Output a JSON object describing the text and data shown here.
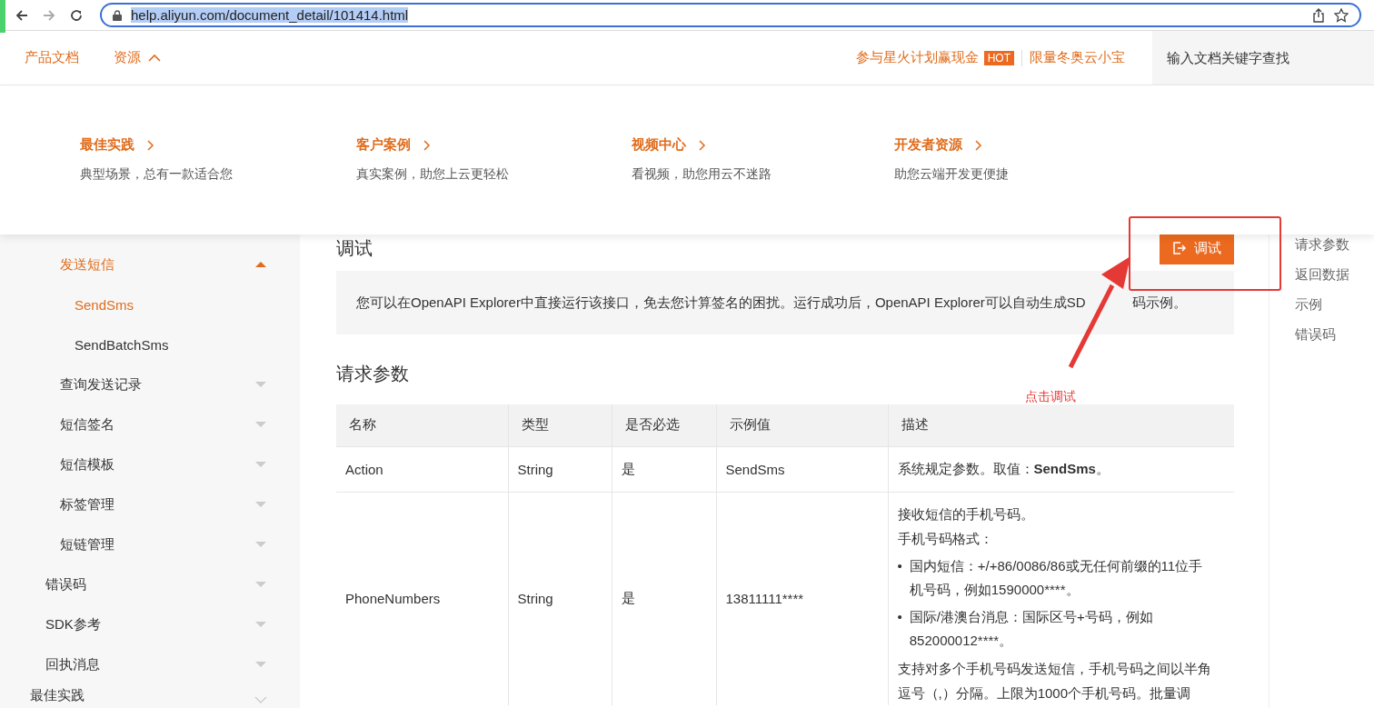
{
  "browser": {
    "url": "help.aliyun.com/document_detail/101414.html",
    "url_selected": true
  },
  "header": {
    "nav": [
      {
        "label": "产品文档",
        "kind": "link"
      },
      {
        "label": "资源",
        "kind": "menu",
        "expanded": true
      }
    ],
    "promo": {
      "label": "参与星火计划赢现金",
      "badge": "HOT"
    },
    "promo_2": "限量冬奥云小宝",
    "search": {
      "placeholder": "输入文档关键字查找"
    }
  },
  "dropdown": [
    {
      "title": "最佳实践",
      "desc": "典型场景，总有一款适合您"
    },
    {
      "title": "客户案例",
      "desc": "真实案例，助您上云更轻松"
    },
    {
      "title": "视频中心",
      "desc": "看视频，助您用云不迷路"
    },
    {
      "title": "开发者资源",
      "desc": "助您云端开发更便捷"
    }
  ],
  "sidebar": {
    "level_2": [
      {
        "label": "发送短信",
        "expanded": true,
        "children": [
          {
            "label": "SendSms",
            "selected": true
          },
          {
            "label": "SendBatchSms",
            "selected": false
          }
        ]
      },
      {
        "label": "查询发送记录",
        "expanded": false
      },
      {
        "label": "短信签名",
        "expanded": false
      },
      {
        "label": "短信模板",
        "expanded": false
      },
      {
        "label": "标签管理",
        "expanded": false
      },
      {
        "label": "短链管理",
        "expanded": false
      }
    ],
    "level_1": [
      {
        "label": "错误码",
        "expanded": false
      },
      {
        "label": "SDK参考",
        "expanded": false
      },
      {
        "label": "回执消息",
        "expanded": false
      }
    ],
    "level_0": [
      {
        "label": "最佳实践",
        "expanded": false
      }
    ]
  },
  "content": {
    "debug_heading": "调试",
    "debug_button": "调试",
    "debug_info": [
      "您可以在OpenAPI Explorer中直接运行该接口，免去您计算签名的困扰。运行成功后，OpenAPI Explorer可以自动生成SD",
      "码示例。"
    ],
    "params_heading": "请求参数",
    "table": {
      "columns": [
        "名称",
        "类型",
        "是否必选",
        "示例值",
        "描述"
      ],
      "rows": [
        {
          "cells": [
            "Action",
            "String",
            "是",
            "SendSms"
          ],
          "desc": [
            "系统规定参数。取值：**SendSms**。"
          ],
          "bullets": [],
          "desc_after": []
        },
        {
          "cells": [
            "PhoneNumbers",
            "String",
            "是",
            "13811111****"
          ],
          "desc": [
            "接收短信的手机号码。",
            "手机号码格式："
          ],
          "bullets": [
            {
              "marker": "•",
              "text": "国内短信：+/+86/0086/86或无任何前缀的11位手机号码，例如1590000****。"
            },
            {
              "marker": "•",
              "text": "国际/港澳台消息：国际区号+号码，例如852000012****。"
            }
          ],
          "desc_after": [
            "支持对多个手机号码发送短信，手机号码之间以半角逗号（,）分隔。上限为1000个手机号码。批量调"
          ]
        }
      ]
    }
  },
  "toc": {
    "items": [
      "请求参数",
      "返回数据",
      "示例",
      "错误码"
    ]
  },
  "annotation": {
    "label": "点击调试"
  }
}
